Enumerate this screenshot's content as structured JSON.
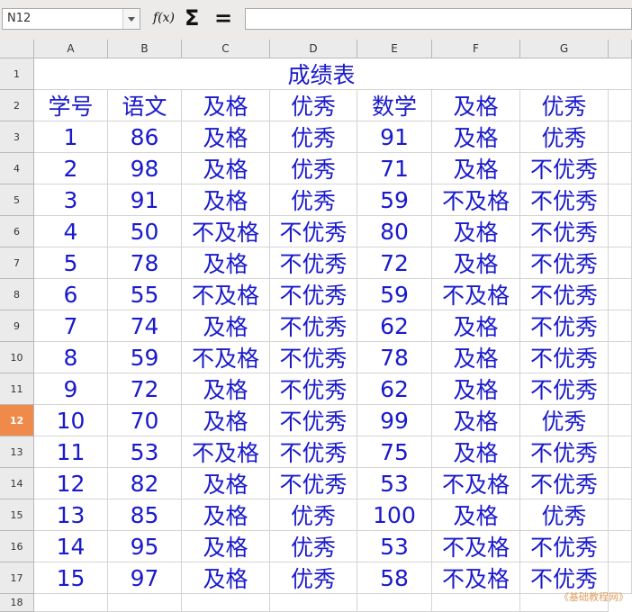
{
  "namebox": {
    "value": "N12"
  },
  "toolbar": {
    "fx_icon": "f(x)",
    "sum_icon": "Σ",
    "equals_icon": "="
  },
  "formula": {
    "value": ""
  },
  "columns": [
    "A",
    "B",
    "C",
    "D",
    "E",
    "F",
    "G"
  ],
  "rows": [
    "1",
    "2",
    "3",
    "4",
    "5",
    "6",
    "7",
    "8",
    "9",
    "10",
    "11",
    "12",
    "13",
    "14",
    "15",
    "16",
    "17",
    "18"
  ],
  "active_row": "12",
  "sheet": {
    "title": "成绩表",
    "header": [
      "学号",
      "语文",
      "及格",
      "优秀",
      "数学",
      "及格",
      "优秀"
    ],
    "data": [
      [
        "1",
        "86",
        "及格",
        "优秀",
        "91",
        "及格",
        "优秀"
      ],
      [
        "2",
        "98",
        "及格",
        "优秀",
        "71",
        "及格",
        "不优秀"
      ],
      [
        "3",
        "91",
        "及格",
        "优秀",
        "59",
        "不及格",
        "不优秀"
      ],
      [
        "4",
        "50",
        "不及格",
        "不优秀",
        "80",
        "及格",
        "不优秀"
      ],
      [
        "5",
        "78",
        "及格",
        "不优秀",
        "72",
        "及格",
        "不优秀"
      ],
      [
        "6",
        "55",
        "不及格",
        "不优秀",
        "59",
        "不及格",
        "不优秀"
      ],
      [
        "7",
        "74",
        "及格",
        "不优秀",
        "62",
        "及格",
        "不优秀"
      ],
      [
        "8",
        "59",
        "不及格",
        "不优秀",
        "78",
        "及格",
        "不优秀"
      ],
      [
        "9",
        "72",
        "及格",
        "不优秀",
        "62",
        "及格",
        "不优秀"
      ],
      [
        "10",
        "70",
        "及格",
        "不优秀",
        "99",
        "及格",
        "优秀"
      ],
      [
        "11",
        "53",
        "不及格",
        "不优秀",
        "75",
        "及格",
        "不优秀"
      ],
      [
        "12",
        "82",
        "及格",
        "不优秀",
        "53",
        "不及格",
        "不优秀"
      ],
      [
        "13",
        "85",
        "及格",
        "优秀",
        "100",
        "及格",
        "优秀"
      ],
      [
        "14",
        "95",
        "及格",
        "优秀",
        "53",
        "不及格",
        "不优秀"
      ],
      [
        "15",
        "97",
        "及格",
        "优秀",
        "58",
        "不及格",
        "不优秀"
      ]
    ]
  },
  "watermark": "《基础教程网》",
  "colors": {
    "text": "#1a1acc",
    "active_row_header": "#f08a4b"
  }
}
